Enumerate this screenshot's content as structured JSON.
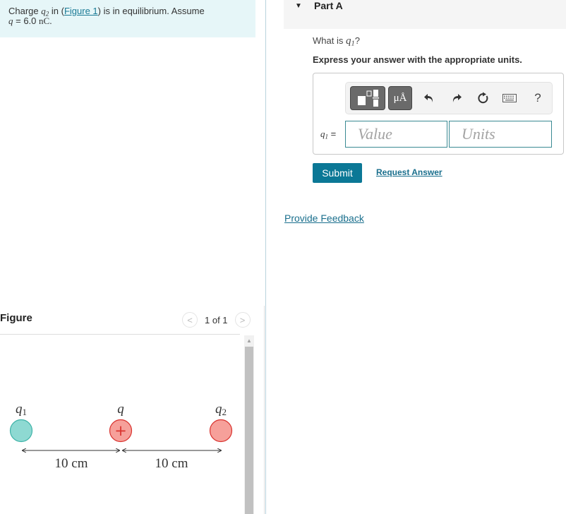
{
  "problem": {
    "prefix": "Charge ",
    "charge_symbol": "q",
    "charge_sub": "2",
    "in_text": " in (",
    "figure_link": "Figure 1",
    "after_link": ") is in equilibrium. Assume",
    "assume_var": "q",
    "assume_eq": " = 6.0 ",
    "assume_unit": "nC",
    "assume_end": "."
  },
  "figure": {
    "title": "Figure",
    "nav_prev": "<",
    "nav_next": ">",
    "page_count": "1 of 1",
    "scroll_up": "▲",
    "diagram": {
      "charges": [
        {
          "label": "q",
          "sub": "1",
          "color": "#8ed9d2",
          "stroke": "#3fb3a8",
          "sign": ""
        },
        {
          "label": "q",
          "sub": "",
          "color": "#f6a09a",
          "stroke": "#d9332f",
          "sign": "+"
        },
        {
          "label": "q",
          "sub": "2",
          "color": "#f6a09a",
          "stroke": "#d9332f",
          "sign": ""
        }
      ],
      "distances": [
        "10 cm",
        "10 cm"
      ]
    }
  },
  "part": {
    "caret": "▼",
    "label": "Part A",
    "question_prefix": "What is ",
    "question_var": "q",
    "question_sub": "1",
    "question_suffix": "?",
    "instruction": "Express your answer with the appropriate units.",
    "toolbar": {
      "units_label": "μÅ",
      "help_label": "?"
    },
    "answer_var": "q",
    "answer_sub": "1",
    "answer_eq": " =",
    "value_placeholder": "Value",
    "units_placeholder": "Units",
    "submit_label": "Submit",
    "request_label": "Request Answer"
  },
  "feedback_label": "Provide Feedback",
  "colors": {
    "accent": "#0b7896",
    "link": "#1a6f8d",
    "intro_bg": "#e6f6f8"
  }
}
